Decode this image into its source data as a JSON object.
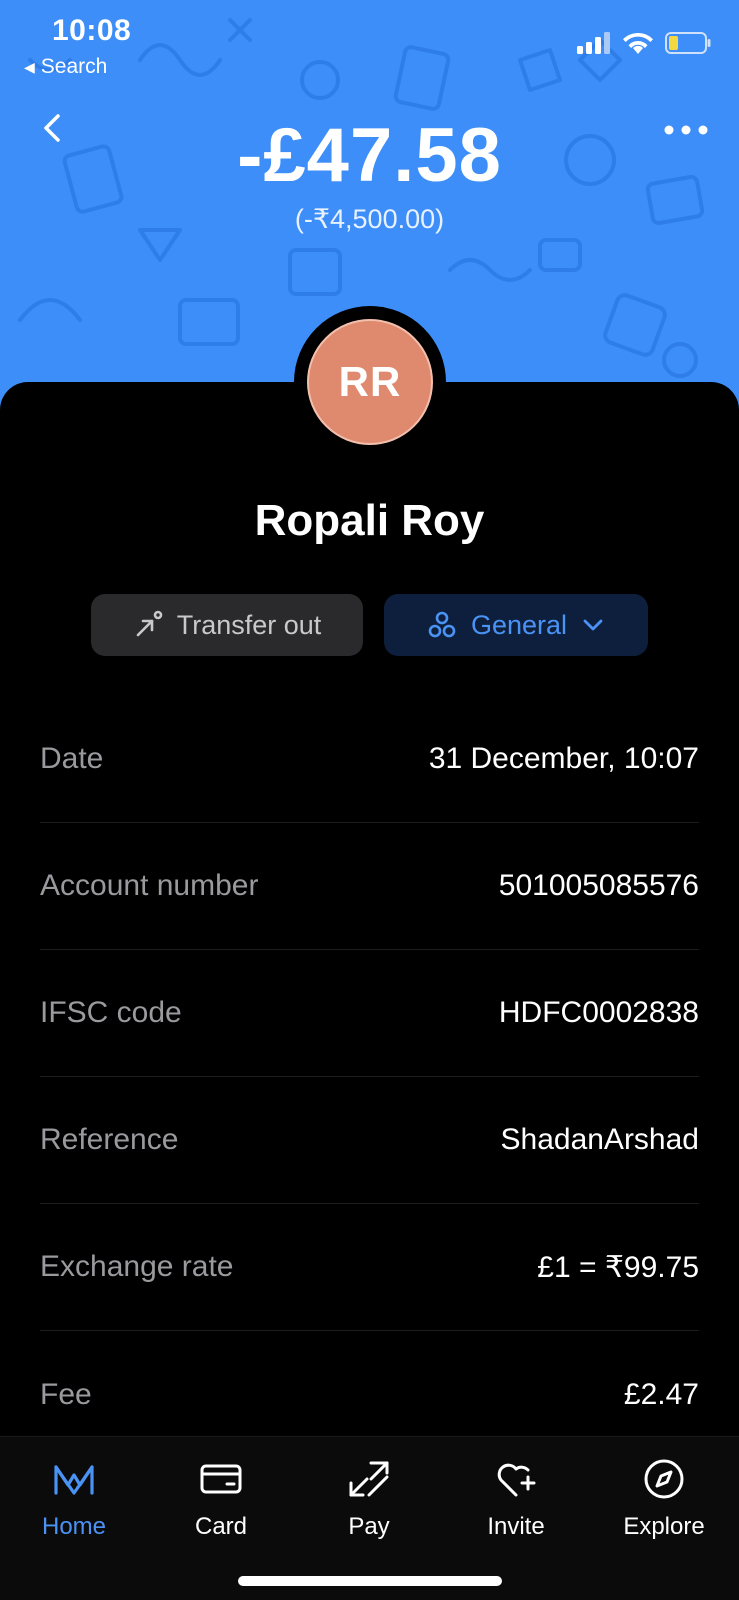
{
  "status_bar": {
    "time": "10:08",
    "back_app": "Search"
  },
  "header": {
    "amount": "-£47.58",
    "amount_local": "(-₹4,500.00)",
    "colors": {
      "background": "#3d8ef8"
    }
  },
  "contact": {
    "initials": "RR",
    "name": "Ropali  Roy",
    "avatar_color": "#df8a6e"
  },
  "chips": {
    "type_label": "Transfer out",
    "type_icon": "arrow-up-right-icon",
    "category_label": "General",
    "category_icon": "category-bubbles-icon",
    "accent": "#4a93f5"
  },
  "details": [
    {
      "label": "Date",
      "value": "31 December, 10:07"
    },
    {
      "label": "Account number",
      "value": "501005085576"
    },
    {
      "label": "IFSC code",
      "value": "HDFC0002838"
    },
    {
      "label": "Reference",
      "value": "ShadanArshad"
    },
    {
      "label": "Exchange rate",
      "value": "£1 = ₹99.75"
    },
    {
      "label": "Fee",
      "value": "£2.47"
    }
  ],
  "tabbar": {
    "items": [
      {
        "label": "Home",
        "icon": "home-m-logo-icon",
        "active": true
      },
      {
        "label": "Card",
        "icon": "card-icon",
        "active": false
      },
      {
        "label": "Pay",
        "icon": "pay-arrows-icon",
        "active": false
      },
      {
        "label": "Invite",
        "icon": "heart-plus-icon",
        "active": false
      },
      {
        "label": "Explore",
        "icon": "compass-icon",
        "active": false
      }
    ]
  }
}
